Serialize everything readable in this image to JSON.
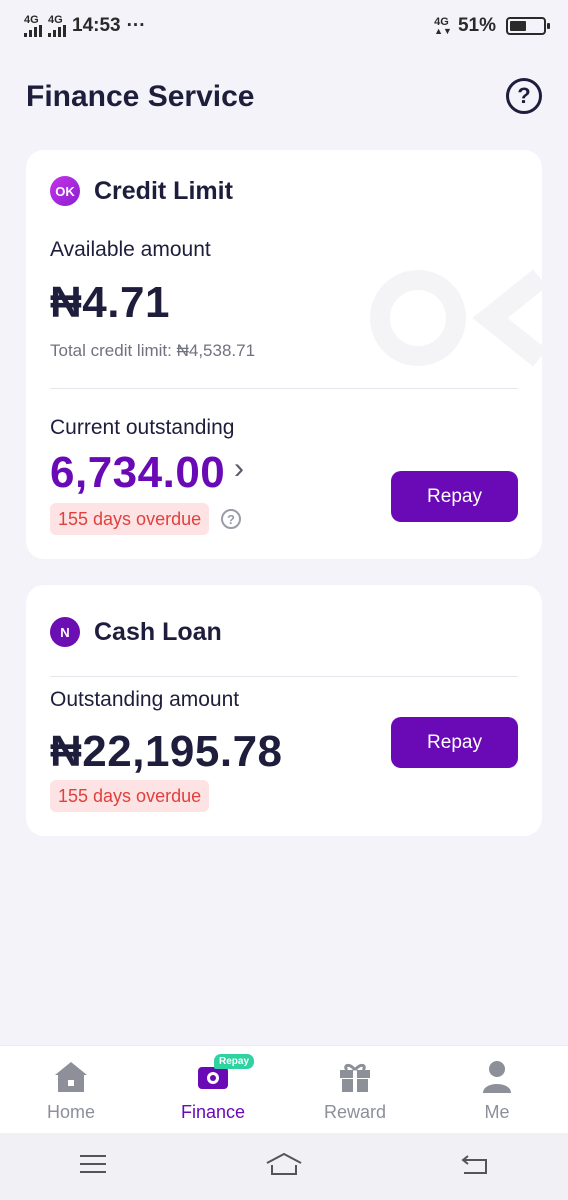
{
  "status_bar": {
    "signal1": "4G",
    "signal2": "4G",
    "time": "14:53",
    "dots": "···",
    "net": "4G",
    "battery": "51%",
    "battery_fraction": 0.51
  },
  "header": {
    "title": "Finance Service",
    "help_glyph": "?"
  },
  "credit_card": {
    "title": "Credit Limit",
    "icon_text": "OK",
    "available_label": "Available amount",
    "available_amount": "₦4.71",
    "total_limit": "Total credit limit: ₦4,538.71",
    "outstanding_label": "Current outstanding",
    "outstanding_amount": "6,734.00",
    "chevron": "›",
    "overdue": "155 days overdue",
    "repay_label": "Repay",
    "watermark_icon": "ok-logo-watermark"
  },
  "loan_card": {
    "title": "Cash Loan",
    "icon_text": "N",
    "outstanding_label": "Outstanding amount",
    "outstanding_amount": "₦22,195.78",
    "overdue": "155 days overdue",
    "repay_label": "Repay"
  },
  "bottom_nav": {
    "items": [
      {
        "label": "Home",
        "icon": "home-icon"
      },
      {
        "label": "Finance",
        "icon": "finance-icon",
        "active": true
      },
      {
        "label": "Reward",
        "icon": "gift-icon"
      },
      {
        "label": "Me",
        "icon": "person-icon"
      }
    ],
    "repay_tag": "Repay"
  },
  "colors": {
    "accent": "#6a0ab6",
    "overdue_text": "#e0403e",
    "overdue_bg": "#fde3e3",
    "badge_green": "#2ed3a0",
    "title": "#1e1e3c"
  }
}
